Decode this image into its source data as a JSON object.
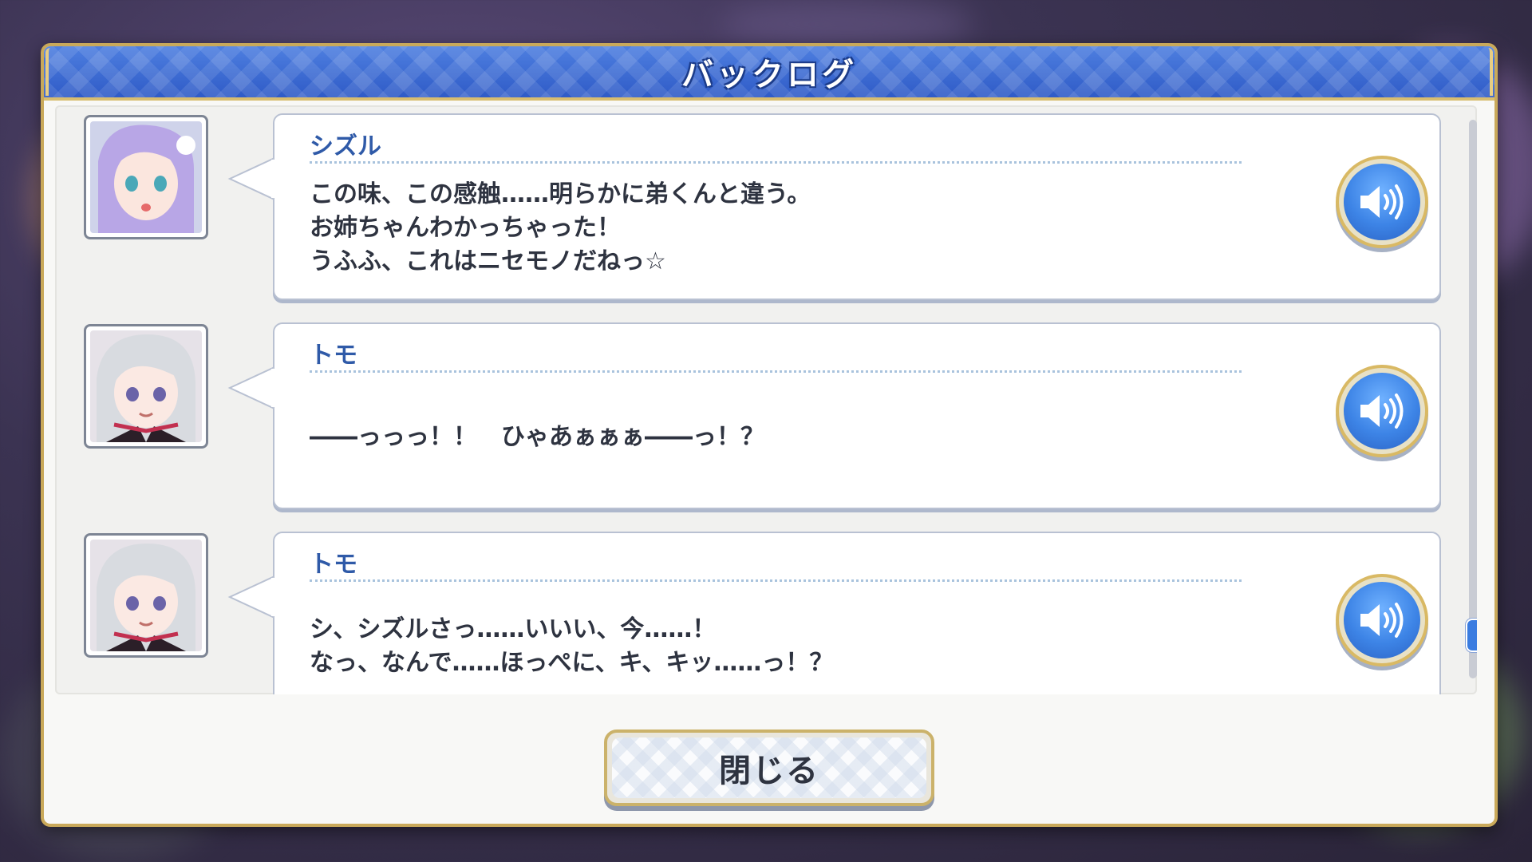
{
  "window": {
    "title": "バックログ"
  },
  "entries": [
    {
      "speaker": "シズル",
      "lines": [
        "この味、この感触……明らかに弟くんと違う。",
        "お姉ちゃんわかっちゃった！",
        "うふふ、これはニセモノだねっ☆"
      ],
      "portrait": {
        "hair_color": "#b8a6e6",
        "eye_color": "#4aa8b8"
      },
      "voice_icon": "speaker-icon"
    },
    {
      "speaker": "トモ",
      "lines": [
        "――っっっ！！　ひゃあぁぁぁ――っ！？"
      ],
      "portrait": {
        "hair_color": "#d8dbe0",
        "eye_color": "#6a63a8"
      },
      "voice_icon": "speaker-icon"
    },
    {
      "speaker": "トモ",
      "lines": [
        "シ、シズルさっ……いいい、今……！",
        "なっ、なんで……ほっぺに、キ、キッ……っ！？"
      ],
      "portrait": {
        "hair_color": "#d8dbe0",
        "eye_color": "#6a63a8"
      },
      "voice_icon": "speaker-icon"
    }
  ],
  "footer": {
    "close_label": "閉じる"
  },
  "scrollbar": {
    "position": 0.95
  },
  "colors": {
    "title_bar": "#3a66d0",
    "gold_border": "#c9a95a",
    "speaker_name": "#2f5aa8",
    "voice_button": "#3d84e6"
  }
}
